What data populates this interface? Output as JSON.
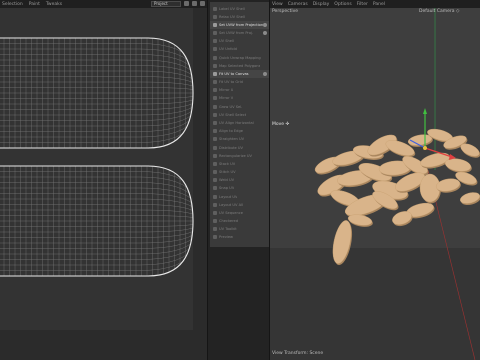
{
  "uv_editor": {
    "menu": [
      "Selection",
      "Paint",
      "Tweaks"
    ],
    "dropdown": "Project",
    "toolbar_icons": [
      "uv-square-icon",
      "uv-lock-icon",
      "uv-link-icon"
    ]
  },
  "command_list": {
    "items": [
      {
        "label": "Label UV Shell",
        "icon": "shell-icon",
        "active": false
      },
      {
        "label": "Relax UV Shell",
        "icon": "relax-icon",
        "active": false
      },
      {
        "label": "Set UVW from Projection",
        "icon": "projection-icon",
        "active": true,
        "info": true
      },
      {
        "label": "Set UVW from Proj.",
        "icon": "projection-icon",
        "active": false,
        "info": true
      },
      {
        "label": "UV Shell",
        "icon": "shell-icon",
        "active": false
      },
      {
        "label": "UV Unfold",
        "icon": "unfold-icon",
        "active": false
      },
      {
        "label": "Quick Unwrap Mapping",
        "icon": "unwrap-icon",
        "active": false
      },
      {
        "label": "Map Selected Polygons",
        "icon": "map-icon",
        "active": false
      },
      {
        "label": "Fit UV to Canvas",
        "icon": "fit-icon",
        "active": true,
        "info": true
      },
      {
        "label": "Fit UV to Grid",
        "icon": "grid-icon",
        "active": false
      },
      {
        "label": "Mirror U",
        "icon": "mirror-u-icon",
        "active": false
      },
      {
        "label": "Mirror V",
        "icon": "mirror-v-icon",
        "active": false
      },
      {
        "label": "Grow UV Sel.",
        "icon": "grow-icon",
        "active": false
      },
      {
        "label": "UV Shell Select",
        "icon": "select-icon",
        "active": false
      },
      {
        "label": "UV Align Horizontal",
        "icon": "align-h-icon",
        "active": false
      },
      {
        "label": "Align to Edge",
        "icon": "align-edge-icon",
        "active": false
      },
      {
        "label": "Straighten UV",
        "icon": "straighten-icon",
        "active": false
      },
      {
        "label": "Distribute UV",
        "icon": "distribute-icon",
        "active": false
      },
      {
        "label": "Rectangularize UV",
        "icon": "rect-icon",
        "active": false
      },
      {
        "label": "Stack UV",
        "icon": "stack-icon",
        "active": false
      },
      {
        "label": "Stitch UV",
        "icon": "stitch-icon",
        "active": false
      },
      {
        "label": "Weld UV",
        "icon": "weld-icon",
        "active": false
      },
      {
        "label": "Snap UV",
        "icon": "snap-icon",
        "active": false
      },
      {
        "label": "Layout UV",
        "icon": "layout-icon",
        "active": false
      },
      {
        "label": "Layout UV All",
        "icon": "layout-icon",
        "active": false
      },
      {
        "label": "UV Sequence",
        "icon": "sequence-icon",
        "active": false
      },
      {
        "label": "Checkered",
        "icon": "checker-icon",
        "active": false
      },
      {
        "label": "UV Toolkit",
        "icon": "toolkit-icon",
        "active": false
      },
      {
        "label": "Preview",
        "icon": "preview-icon",
        "active": false
      }
    ]
  },
  "viewport": {
    "menu": [
      "View",
      "Cameras",
      "Display",
      "Options",
      "Filter",
      "Panel"
    ],
    "perspective_label": "Perspective",
    "camera_label": "Default Camera ◇",
    "move_label": "Move ✣",
    "footer": "View Transform: Scene",
    "colors": {
      "seed": "#d9b48a",
      "seed_shadow": "#a8855e",
      "axis_x": "#e04040",
      "axis_y": "#40c040",
      "axis_z": "#4060e0"
    }
  }
}
